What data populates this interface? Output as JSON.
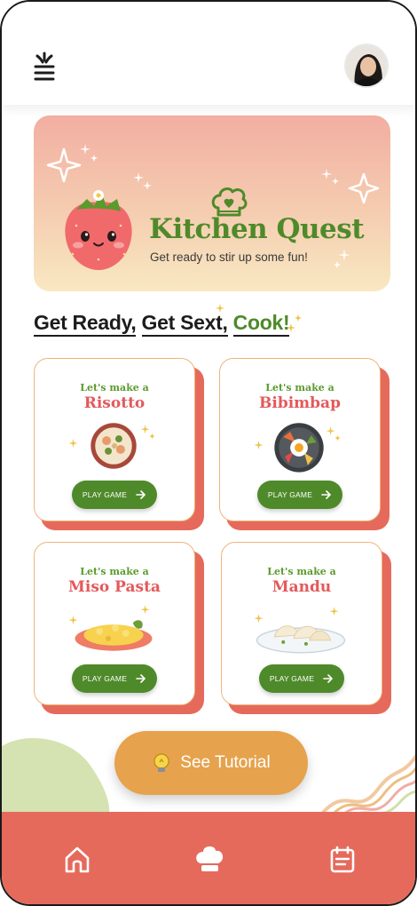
{
  "header": {
    "menu_icon": "menu-icon",
    "avatar_icon": "user-avatar"
  },
  "banner": {
    "title": "Kitchen Quest",
    "subtitle": "Get ready to stir up some fun!",
    "mascot": "strawberry-mascot",
    "logo_icon": "chef-hat-heart-icon"
  },
  "section": {
    "title_part1": "Get Ready,",
    "title_part2": "Get Sext,",
    "title_part3": "Cook!"
  },
  "cards": [
    {
      "kicker": "Let's make a",
      "name": "Risotto",
      "button": "PLAY GAME",
      "dish_icon": "risotto-dish"
    },
    {
      "kicker": "Let's make a",
      "name": "Bibimbap",
      "button": "PLAY GAME",
      "dish_icon": "bibimbap-dish"
    },
    {
      "kicker": "Let's make a",
      "name": "Miso Pasta",
      "button": "PLAY GAME",
      "dish_icon": "miso-pasta-dish"
    },
    {
      "kicker": "Let's make a",
      "name": "Mandu",
      "button": "PLAY GAME",
      "dish_icon": "mandu-dish"
    }
  ],
  "tutorial": {
    "label": "See Tutorial",
    "icon": "lightbulb-icon"
  },
  "nav": {
    "items": [
      "home-icon",
      "chef-hat-icon",
      "calendar-icon"
    ]
  },
  "colors": {
    "brand_green": "#4e8a2a",
    "accent_red": "#e56a5c",
    "accent_orange": "#e6a24d",
    "title_red": "#e4595b"
  }
}
